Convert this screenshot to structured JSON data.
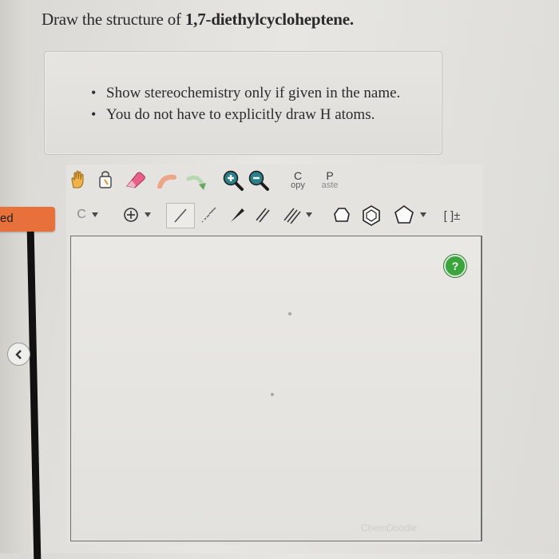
{
  "question": {
    "prefix": "Draw the structure of ",
    "compound": "1,7-diethylcycloheptene."
  },
  "instructions": [
    "Show stereochemistry only if given in the name.",
    "You do not have to explicitly draw H atoms."
  ],
  "toolbar": {
    "copy_top": "C",
    "copy_bottom": "opy",
    "paste_top": "P",
    "paste_bottom": "aste",
    "atom_label": "C",
    "charge_label": "[ ]±"
  },
  "side_tab": {
    "label": "ed"
  },
  "canvas": {
    "help_label": "?",
    "watermark": "ChemDoodle"
  },
  "icons": [
    "hand-icon",
    "lasso-icon",
    "eraser-icon",
    "undo-icon",
    "redo-icon",
    "zoom-in-icon",
    "zoom-out-icon",
    "charge-icon",
    "single-bond-icon",
    "hashed-bond-icon",
    "wedge-bond-icon",
    "double-bond-icon",
    "triple-bond-icon",
    "triangle-ring-icon",
    "benzene-ring-icon",
    "pentagon-ring-icon",
    "chevron-down-icon",
    "collapse-chevron-icon"
  ],
  "colors": {
    "accent_tab": "#e8703a",
    "help": "#39a53a",
    "zoom": "#2a7f8a",
    "undo": "#e59a7f"
  }
}
